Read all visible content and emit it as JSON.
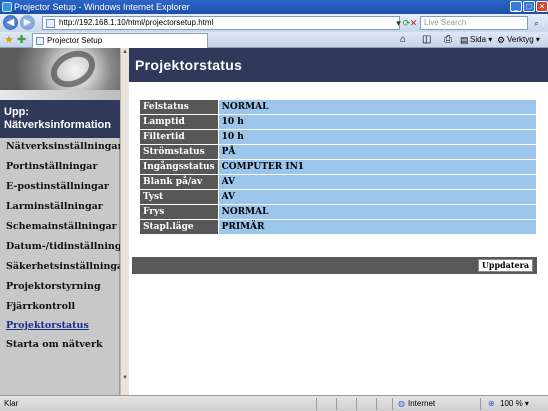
{
  "browser": {
    "window_title": "Projector Setup - Windows Internet Explorer",
    "address": "http://192.168.1.10/html/projectorsetup.html",
    "search_placeholder": "Live Search",
    "tab_title": "Projector Setup",
    "tools": {
      "page": "Sida",
      "tools": "Verktyg"
    }
  },
  "sidebar": {
    "heading": "Upp: Nätverksinformation",
    "items": [
      {
        "label": "Nätverksinställningar",
        "active": false
      },
      {
        "label": "Portinställningar",
        "active": false
      },
      {
        "label": "E-postinställningar",
        "active": false
      },
      {
        "label": "Larminställningar",
        "active": false
      },
      {
        "label": "Schemainställningar",
        "active": false
      },
      {
        "label": "Datum-/tidinställningar",
        "active": false
      },
      {
        "label": "Säkerhetsinställningar",
        "active": false
      },
      {
        "label": "Projektorstyrning",
        "active": false
      },
      {
        "label": "Fjärrkontroll",
        "active": false
      },
      {
        "label": "Projektorstatus",
        "active": true
      },
      {
        "label": "Starta om nätverk",
        "active": false
      }
    ]
  },
  "main": {
    "title": "Projektorstatus",
    "rows": [
      {
        "label": "Felstatus",
        "value": "NORMAL"
      },
      {
        "label": "Lamptid",
        "value": "10 h"
      },
      {
        "label": "Filtertid",
        "value": "10 h"
      },
      {
        "label": "Strömstatus",
        "value": "PÅ"
      },
      {
        "label": "Ingångsstatus",
        "value": "COMPUTER IN1"
      },
      {
        "label": "Blank på/av",
        "value": "AV"
      },
      {
        "label": "Tyst",
        "value": "AV"
      },
      {
        "label": "Frys",
        "value": "NORMAL"
      },
      {
        "label": "Stapl.läge",
        "value": "PRIMÄR"
      }
    ],
    "update_button": "Uppdatera"
  },
  "statusbar": {
    "left": "Klar",
    "zone": "Internet",
    "zoom": "100 %"
  },
  "colors": {
    "header_bg": "#31395a",
    "label_bg": "#575757",
    "value_bg": "#9cc5eb",
    "active_link": "#1d2f8c"
  },
  "icons": [
    "back-arrow-icon",
    "forward-arrow-icon",
    "refresh-icon",
    "stop-icon",
    "search-icon",
    "favorites-star-icon",
    "home-icon",
    "print-icon",
    "page-icon",
    "gear-icon",
    "globe-icon",
    "zoom-icon"
  ]
}
